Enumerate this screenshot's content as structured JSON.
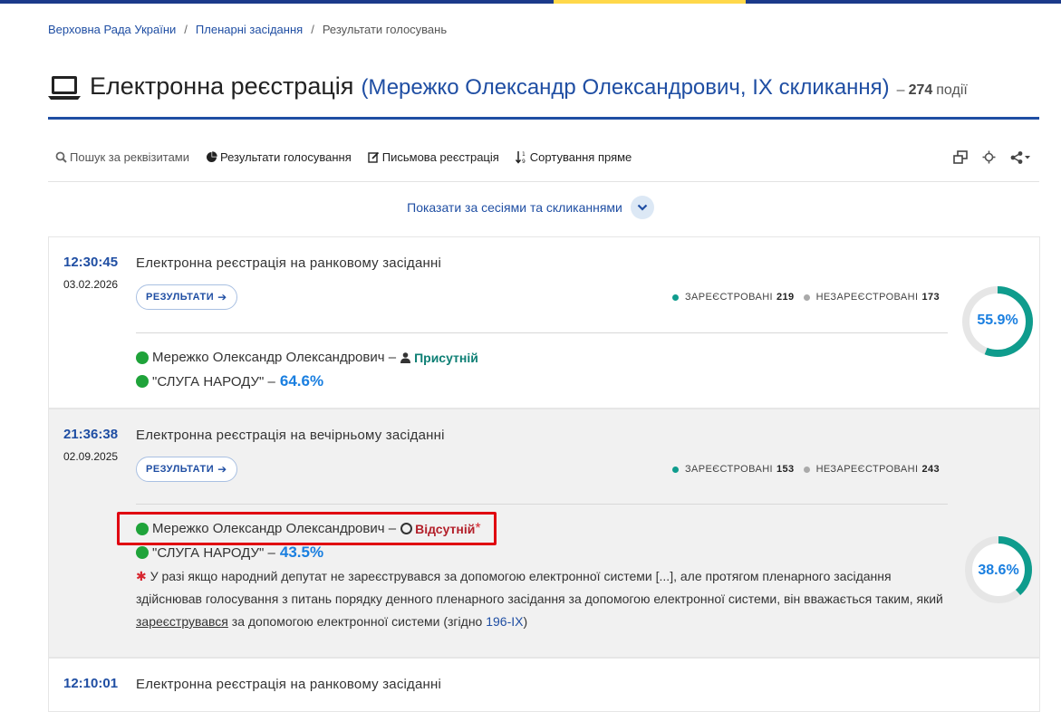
{
  "breadcrumb": {
    "items": [
      "Верховна Рада України",
      "Пленарні засідання",
      "Результати голосувань"
    ]
  },
  "header": {
    "title": "Електронна реєстрація",
    "subtitle": "(Мережко Олександр Олександрович, IX скликання)",
    "dash": "–",
    "count": "274",
    "count_label": "події"
  },
  "toolbar": {
    "search": "Пошук за реквізитами",
    "results": "Результати голосування",
    "written": "Письмова реєстрація",
    "sort": "Сортування пряме"
  },
  "sessions_toggle": "Показати за сесіями та скликаннями",
  "events": [
    {
      "time": "12:30:45",
      "date": "03.02.2026",
      "title": "Електронна реєстрація на ранковому засіданні",
      "button": "РЕЗУЛЬТАТИ",
      "registered_label": "ЗАРЕЄСТРОВАНІ",
      "registered": "219",
      "unregistered_label": "НЕЗАРЕЄСТРОВАНІ",
      "unregistered": "173",
      "percent": "55.9%",
      "percent_value": 55.9,
      "deputy": "Мережко Олександр Олександрович –",
      "status": "Присутній",
      "faction": "\"СЛУГА НАРОДУ\" –",
      "faction_percent": "64.6%"
    },
    {
      "time": "21:36:38",
      "date": "02.09.2025",
      "title": "Електронна реєстрація на вечірньому засіданні",
      "button": "РЕЗУЛЬТАТИ",
      "registered_label": "ЗАРЕЄСТРОВАНІ",
      "registered": "153",
      "unregistered_label": "НЕЗАРЕЄСТРОВАНІ",
      "unregistered": "243",
      "percent": "38.6%",
      "percent_value": 38.6,
      "deputy": "Мережко Олександр Олександрович –",
      "status": "Відсутній",
      "faction": "\"СЛУГА НАРОДУ\" –",
      "faction_percent": "43.5%",
      "note_part1": "У разі якщо народний депутат не зареєструвався за допомогою електронної системи [...], але протягом пленарного засідання здійснював голосування з питань порядку денного пленарного засідання за допомогою електронної системи, він вважається таким, який ",
      "note_underlined": "зареєструвався",
      "note_part2": " за допомогою електронної системи (згідно ",
      "note_link": "196-IX",
      "note_end": ")"
    },
    {
      "time": "12:10:01",
      "title": "Електронна реєстрація на ранковому засіданні"
    }
  ],
  "colors": {
    "primary": "#1f4ea3",
    "teal": "#0f9c8d",
    "absent": "#b3202a",
    "percent": "#1a7fe0"
  }
}
